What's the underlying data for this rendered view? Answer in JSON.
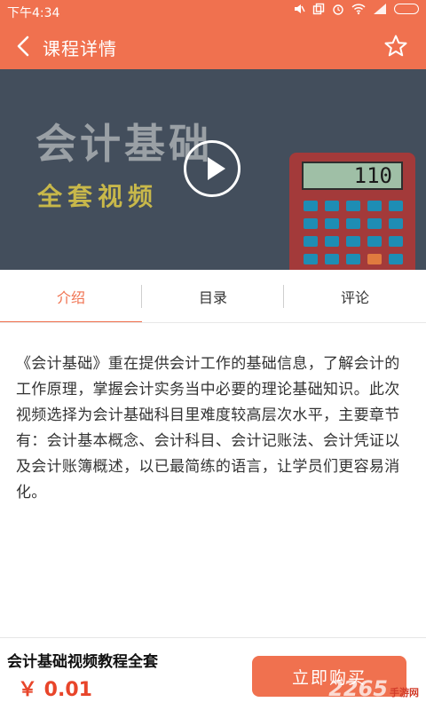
{
  "status_bar": {
    "time": "下午4:34",
    "icons": [
      "mute-icon",
      "copy-icon",
      "alarm-icon",
      "wifi-icon",
      "signal-icon",
      "battery-icon"
    ]
  },
  "app_bar": {
    "title": "课程详情",
    "back_icon": "back-arrow-icon",
    "favorite_icon": "star-outline-icon"
  },
  "hero": {
    "line1": "会计基础",
    "line2": "全套视频",
    "calculator_display": "110",
    "play_icon": "play-icon"
  },
  "tabs": [
    {
      "label": "介绍",
      "active": true
    },
    {
      "label": "目录",
      "active": false
    },
    {
      "label": "评论",
      "active": false
    }
  ],
  "description": "《会计基础》重在提供会计工作的基础信息，了解会计的工作原理，掌握会计实务当中必要的理论基础知识。此次视频选择为会计基础科目里难度较高层次水平，主要章节有：会计基本概念、会计科目、会计记账法、会计凭证以及会计账簿概述，以已最简练的语言，让学员们更容易消化。",
  "bottom_bar": {
    "course_name": "会计基础视频教程全套",
    "price": "￥ 0.01",
    "buy_label": "立即购买",
    "watermark": "2265",
    "watermark_sub": "手游网"
  },
  "colors": {
    "accent": "#f0714f",
    "price": "#e8452a",
    "hero_bg": "#434e5c"
  }
}
